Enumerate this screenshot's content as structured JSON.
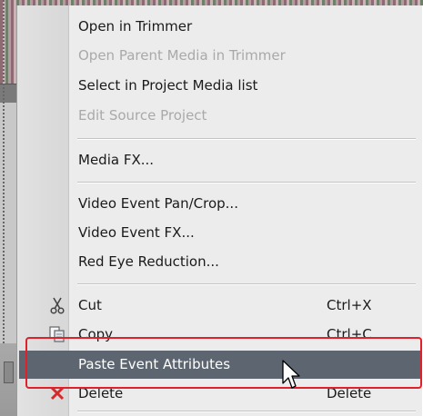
{
  "menu": {
    "items": [
      {
        "label": "Open in Trimmer",
        "disabled": false
      },
      {
        "label": "Open Parent Media in Trimmer",
        "disabled": true
      },
      {
        "label": "Select in Project Media list",
        "disabled": false
      },
      {
        "label": "Edit Source Project",
        "disabled": true
      },
      {
        "label": "Media FX...",
        "disabled": false
      },
      {
        "label": "Video Event Pan/Crop...",
        "disabled": false
      },
      {
        "label": "Video Event FX...",
        "disabled": false
      },
      {
        "label": "Red Eye Reduction...",
        "disabled": false
      },
      {
        "label": "Cut",
        "shortcut": "Ctrl+X",
        "icon": "scissors-icon"
      },
      {
        "label": "Copy",
        "shortcut": "Ctrl+C",
        "icon": "copy-icon"
      },
      {
        "label": "Paste Event Attributes",
        "selected": true
      },
      {
        "label": "Delete",
        "shortcut": "Delete",
        "icon": "delete-x-icon"
      }
    ]
  },
  "annotation": {
    "color": "#e0202a"
  },
  "colors": {
    "highlight": "#5d6670",
    "menu_bg": "#ececec",
    "disabled_text": "#a9a9a9"
  }
}
